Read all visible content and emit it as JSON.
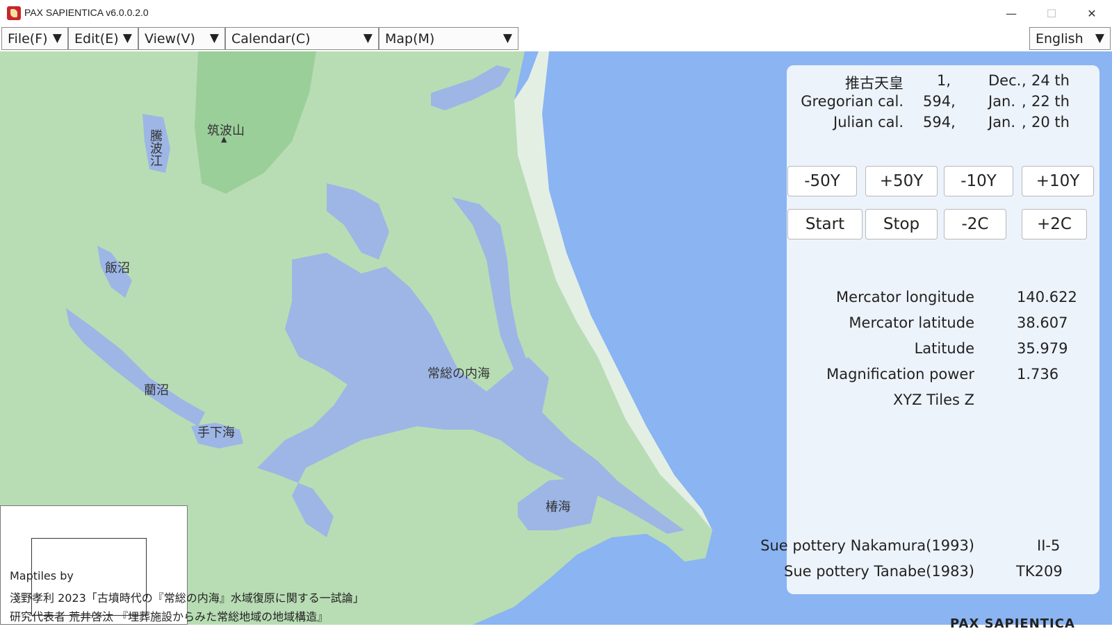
{
  "window": {
    "title": "PAX SAPIENTICA v6.0.0.2.0",
    "minimize_glyph": "—",
    "maximize_glyph": "☐",
    "close_glyph": "✕"
  },
  "menubar": {
    "file": "File(F)",
    "edit": "Edit(E)",
    "view": "View(V)",
    "calendar": "Calendar(C)",
    "map": "Map(M)",
    "dropdown_arrow": "▼",
    "language": "English"
  },
  "map": {
    "labels": {
      "tsukuba": "筑波山",
      "tsukuba_marker": "▲",
      "tobanoe": "騰波江",
      "iinuma": "飯沼",
      "ranuma": "藺沼",
      "teganoumi": "手下海",
      "josonouchiumi": "常総の内海",
      "tsubakiumi": "椿海"
    },
    "colors": {
      "ocean": "#8ab4f2",
      "land": "#b8ddb4",
      "inland_water": "#9db6e6",
      "highland": "#8fc98f",
      "site_marker": "#1e9c4a"
    }
  },
  "credits": {
    "line1": "Maptiles by",
    "line2": "淺野孝利 2023「古墳時代の『常総の内海』水域復原に関する一試論」",
    "line3": "研究代表者 荒井啓汰 『埋葬施設からみた常総地域の地域構造』"
  },
  "panel": {
    "calendars": [
      {
        "name": "推古天皇",
        "year": "1,",
        "month": "Dec.",
        "sep": ",",
        "day": "24 th"
      },
      {
        "name": "Gregorian cal.",
        "year": "594,",
        "month": "Jan.",
        "sep": ",",
        "day": "22 th"
      },
      {
        "name": "Julian cal.",
        "year": "594,",
        "month": "Jan.",
        "sep": ",",
        "day": "20 th"
      }
    ],
    "buttons_row1": [
      "-50Y",
      "+50Y",
      "-10Y",
      "+10Y"
    ],
    "buttons_row2": [
      "Start",
      "Stop",
      "-2C",
      "+2C"
    ],
    "info": [
      {
        "label": "Mercator longitude",
        "value": "140.622"
      },
      {
        "label": "Mercator latitude",
        "value": "38.607"
      },
      {
        "label": "Latitude",
        "value": "35.979"
      },
      {
        "label": "Magnification power",
        "value": "1.736"
      },
      {
        "label": "XYZ Tiles Z",
        "value": ""
      }
    ],
    "pottery": [
      {
        "label": "Sue pottery Nakamura(1993)",
        "value": "II-5"
      },
      {
        "label": "Sue pottery Tanabe(1983)",
        "value": "TK209"
      }
    ]
  },
  "watermark": "PAX SAPIENTICA"
}
